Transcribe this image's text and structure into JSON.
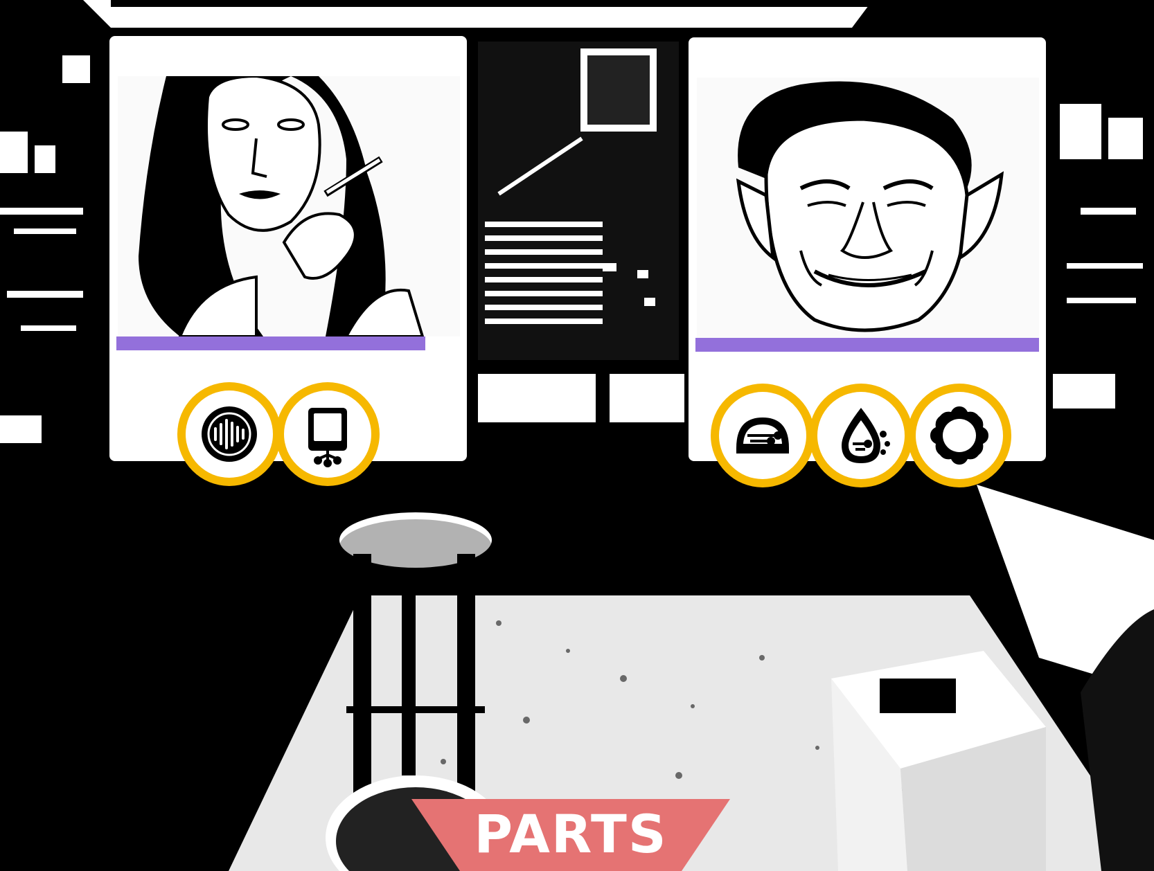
{
  "scene": {
    "description_icon": "garage-workshop-background"
  },
  "characters": [
    {
      "portrait_icon": "long-haired-woman-smoking-portrait",
      "health_fraction": 0.9,
      "bar_color": "#9370db",
      "badges": [
        {
          "icon": "soundwave-circle-icon"
        },
        {
          "icon": "tablet-circuit-icon"
        }
      ]
    },
    {
      "portrait_icon": "pointy-eared-man-portrait",
      "health_fraction": 1.0,
      "bar_color": "#9370db",
      "badges": [
        {
          "icon": "gauge-circuit-icon"
        },
        {
          "icon": "droplet-circuit-icon"
        },
        {
          "icon": "gear-ring-icon"
        }
      ]
    }
  ],
  "parts_button": {
    "label": "PARTS",
    "color": "#e57373"
  },
  "colors": {
    "badge_ring": "#f6b800",
    "accent_purple": "#9370db"
  }
}
